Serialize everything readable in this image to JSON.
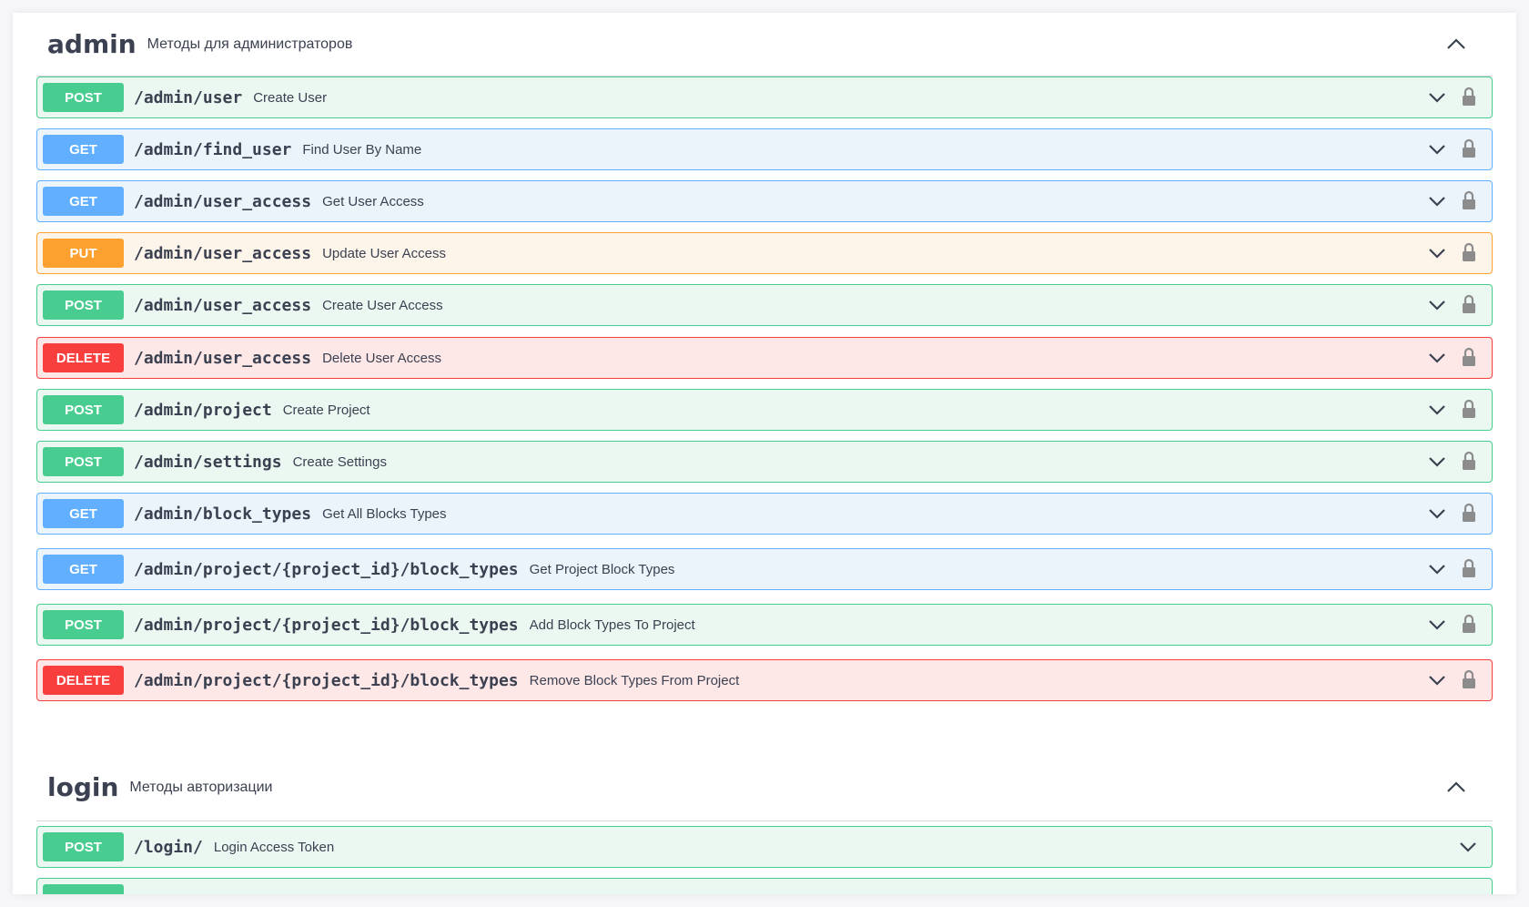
{
  "sections": [
    {
      "name": "admin",
      "description": "Методы для администраторов",
      "operations": [
        {
          "method": "POST",
          "path": "/admin/user",
          "summary": "Create User"
        },
        {
          "method": "GET",
          "path": "/admin/find_user",
          "summary": "Find User By Name"
        },
        {
          "method": "GET",
          "path": "/admin/user_access",
          "summary": "Get User Access"
        },
        {
          "method": "PUT",
          "path": "/admin/user_access",
          "summary": "Update User Access"
        },
        {
          "method": "POST",
          "path": "/admin/user_access",
          "summary": "Create User Access"
        },
        {
          "method": "DELETE",
          "path": "/admin/user_access",
          "summary": "Delete User Access"
        },
        {
          "method": "POST",
          "path": "/admin/project",
          "summary": "Create Project"
        },
        {
          "method": "POST",
          "path": "/admin/settings",
          "summary": "Create Settings"
        },
        {
          "method": "GET",
          "path": "/admin/block_types",
          "summary": "Get All Blocks Types"
        },
        {
          "method": "GET",
          "path": "/admin/project/{project_id}/block_types",
          "summary": "Get Project Block Types"
        },
        {
          "method": "POST",
          "path": "/admin/project/{project_id}/block_types",
          "summary": "Add Block Types To Project"
        },
        {
          "method": "DELETE",
          "path": "/admin/project/{project_id}/block_types",
          "summary": "Remove Block Types From Project"
        }
      ]
    },
    {
      "name": "login",
      "description": "Методы авторизации",
      "operations": [
        {
          "method": "POST",
          "path": "/login/",
          "summary": "Login Access Token"
        }
      ]
    }
  ],
  "colors": {
    "post": "#49cc90",
    "get": "#61affe",
    "put": "#fca130",
    "delete": "#f93e3e"
  },
  "icons": {
    "expand": "chevron-down-icon",
    "collapse": "chevron-up-icon",
    "auth": "lock-icon"
  }
}
